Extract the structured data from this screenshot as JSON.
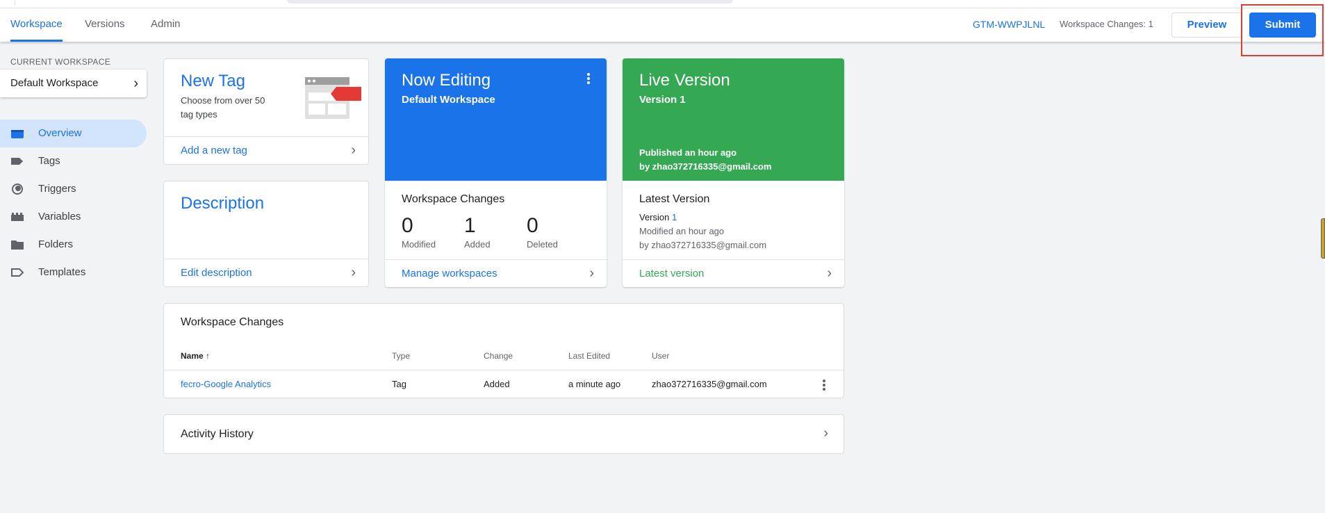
{
  "header": {
    "tabs": [
      {
        "label": "Workspace",
        "active": true
      },
      {
        "label": "Versions",
        "active": false
      },
      {
        "label": "Admin",
        "active": false
      }
    ],
    "container_id": "GTM-WWPJLNL",
    "workspace_changes": "Workspace Changes: 1",
    "preview_label": "Preview",
    "submit_label": "Submit"
  },
  "sidebar": {
    "section_label": "CURRENT WORKSPACE",
    "workspace_name": "Default Workspace",
    "items": [
      {
        "label": "Overview",
        "icon": "overview-icon",
        "active": true
      },
      {
        "label": "Tags",
        "icon": "tag-icon"
      },
      {
        "label": "Triggers",
        "icon": "trigger-icon"
      },
      {
        "label": "Variables",
        "icon": "variables-icon"
      },
      {
        "label": "Folders",
        "icon": "folder-icon"
      },
      {
        "label": "Templates",
        "icon": "template-icon"
      }
    ]
  },
  "new_tag_card": {
    "title": "New Tag",
    "desc_line1": "Choose from over 50",
    "desc_line2": "tag types",
    "link": "Add a new tag"
  },
  "description_card": {
    "title": "Description",
    "link": "Edit description"
  },
  "now_editing_card": {
    "title": "Now Editing",
    "subtitle": "Default Workspace",
    "changes_title": "Workspace Changes",
    "stats": [
      {
        "value": "0",
        "label": "Modified"
      },
      {
        "value": "1",
        "label": "Added"
      },
      {
        "value": "0",
        "label": "Deleted"
      }
    ],
    "link": "Manage workspaces"
  },
  "live_version_card": {
    "title": "Live Version",
    "subtitle": "Version 1",
    "published": "Published an hour ago",
    "by": "by zhao372716335@gmail.com",
    "latest_title": "Latest Version",
    "latest_version_prefix": "Version ",
    "latest_version_number": "1",
    "latest_modified": "Modified an hour ago",
    "latest_by": "by zhao372716335@gmail.com",
    "link": "Latest version"
  },
  "changes_table": {
    "title": "Workspace Changes",
    "columns": [
      "Name",
      "Type",
      "Change",
      "Last Edited",
      "User"
    ],
    "sort_indicator": "↑",
    "rows": [
      {
        "name": "fecro-Google Analytics",
        "type": "Tag",
        "change": "Added",
        "last_edited": "a minute ago",
        "user": "zhao372716335@gmail.com"
      }
    ]
  },
  "activity_history": {
    "title": "Activity History"
  },
  "colors": {
    "accent_blue": "#1a73e8",
    "live_green": "#34a853",
    "highlight_red": "#e53935"
  }
}
